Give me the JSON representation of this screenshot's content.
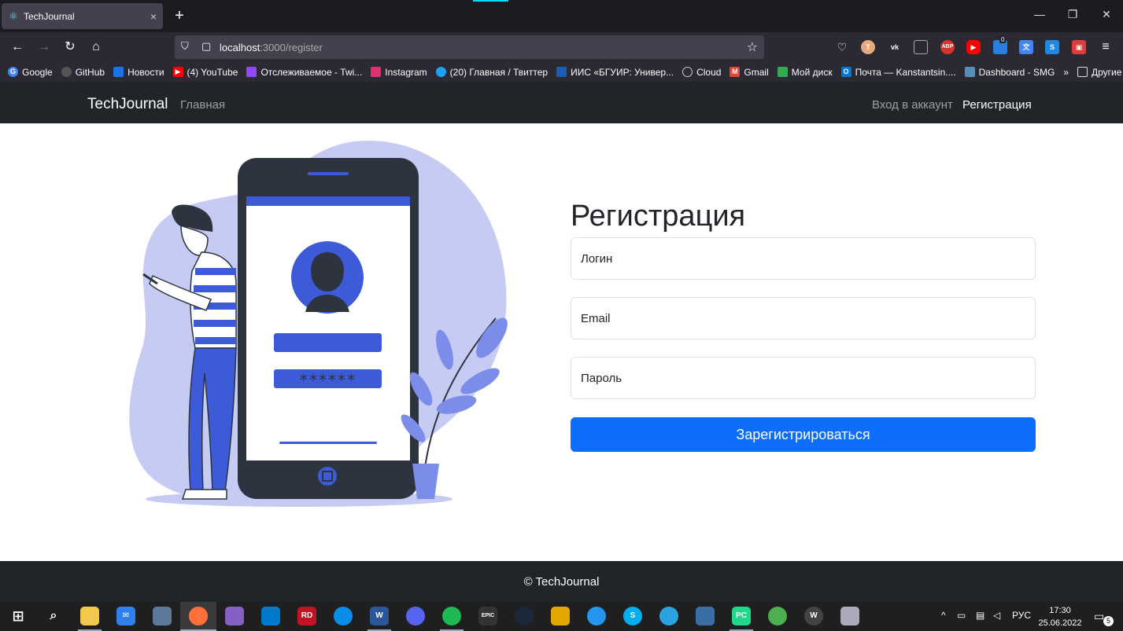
{
  "browser": {
    "tab_title": "TechJournal",
    "url_host": "localhost",
    "url_path": ":3000/register",
    "new_tab": "+",
    "tab_close": "×",
    "window_controls": [
      "—",
      "❐",
      "✕"
    ],
    "bookmarks": [
      {
        "label": "Google",
        "icon": "google-icon",
        "color": "#4285f4"
      },
      {
        "label": "GitHub",
        "icon": "github-icon",
        "color": "#333333"
      },
      {
        "label": "Новости",
        "icon": "news-icon",
        "color": "#1a73e8"
      },
      {
        "label": "(4) YouTube",
        "icon": "youtube-icon",
        "color": "#ff0000"
      },
      {
        "label": "Отслеживаемое - Twi...",
        "icon": "twitch-icon",
        "color": "#9146ff"
      },
      {
        "label": "Instagram",
        "icon": "instagram-icon",
        "color": "#e1306c"
      },
      {
        "label": "(20) Главная / Твиттер",
        "icon": "twitter-icon",
        "color": "#1da1f2"
      },
      {
        "label": "ИИС «БГУИР: Универ...",
        "icon": "bsuir-icon",
        "color": "#1a5fb4"
      },
      {
        "label": "Cloud",
        "icon": "globe-icon",
        "color": "#888888"
      },
      {
        "label": "Gmail",
        "icon": "gmail-icon",
        "color": "#ea4335"
      },
      {
        "label": "Мой диск",
        "icon": "drive-icon",
        "color": "#34a853"
      },
      {
        "label": "Почта — Kanstantsin....",
        "icon": "outlook-icon",
        "color": "#0078d4"
      },
      {
        "label": "Dashboard - SMG",
        "icon": "dashboard-icon",
        "color": "#5b8db8"
      }
    ],
    "bookmarks_more": "»",
    "other_bookmarks": "Другие закладки",
    "ext_badge": "0"
  },
  "site": {
    "brand": "TechJournal",
    "nav_home": "Главная",
    "nav_login": "Вход в аккаунт",
    "nav_register": "Регистрация",
    "form": {
      "title": "Регистрация",
      "login_placeholder": "Логин",
      "email_placeholder": "Email",
      "password_placeholder": "Пароль",
      "submit": "Зарегистрироваться"
    },
    "illustration_password_mask": "******",
    "footer": "© TechJournal"
  },
  "colors": {
    "primary": "#0d6efd",
    "navbar": "#212529",
    "illustration_accent": "#3d5bd9",
    "illustration_blob": "#c5cbf2"
  },
  "taskbar": {
    "tray_lang": "РУС",
    "time": "17:30",
    "date": "25.06.2022",
    "notification_count": "5"
  }
}
